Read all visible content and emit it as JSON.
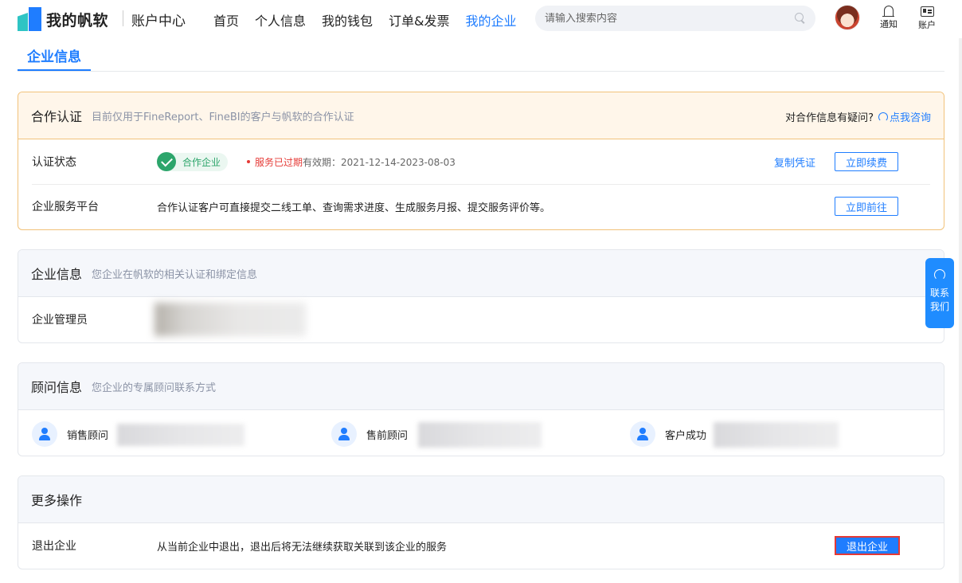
{
  "header": {
    "logo_text": "我的帆软",
    "subtitle": "账户中心",
    "nav": [
      {
        "label": "首页",
        "active": false
      },
      {
        "label": "个人信息",
        "active": false
      },
      {
        "label": "我的钱包",
        "active": false
      },
      {
        "label": "订单&发票",
        "active": false
      },
      {
        "label": "我的企业",
        "active": true
      }
    ],
    "search_placeholder": "请输入搜索内容",
    "notify_label": "通知",
    "account_label": "账户"
  },
  "page_title": "企业信息",
  "coop": {
    "title": "合作认证",
    "desc": "目前仅用于FineReport、FineBI的客户与帆软的合作认证",
    "help_text": "对合作信息有疑问?",
    "help_link": "点我咨询",
    "status_label": "认证状态",
    "badge": "合作企业",
    "expired": "服务已过期",
    "validity": "有效期：2021-12-14-2023-08-03",
    "copy_link": "复制凭证",
    "renew_button": "立即续费",
    "platform_label": "企业服务平台",
    "platform_desc": "合作认证客户可直接提交二线工单、查询需求进度、生成服务月报、提交服务评价等。",
    "goto_button": "立即前往"
  },
  "info": {
    "title": "企业信息",
    "desc": "您企业在帆软的相关认证和绑定信息",
    "admin_label": "企业管理员"
  },
  "advisor": {
    "title": "顾问信息",
    "desc": "您企业的专属顾问联系方式",
    "items": [
      {
        "label": "销售顾问"
      },
      {
        "label": "售前顾问"
      },
      {
        "label": "客户成功"
      }
    ]
  },
  "more": {
    "title": "更多操作",
    "exit_label": "退出企业",
    "exit_desc": "从当前企业中退出，退出后将无法继续获取关联到该企业的服务",
    "exit_button": "退出企业"
  },
  "contact": {
    "label": "联系我们"
  },
  "colors": {
    "accent": "#1f7dff",
    "warning_border": "#f2c27a",
    "expired": "#e53935",
    "badge_green": "#2ca56b"
  }
}
